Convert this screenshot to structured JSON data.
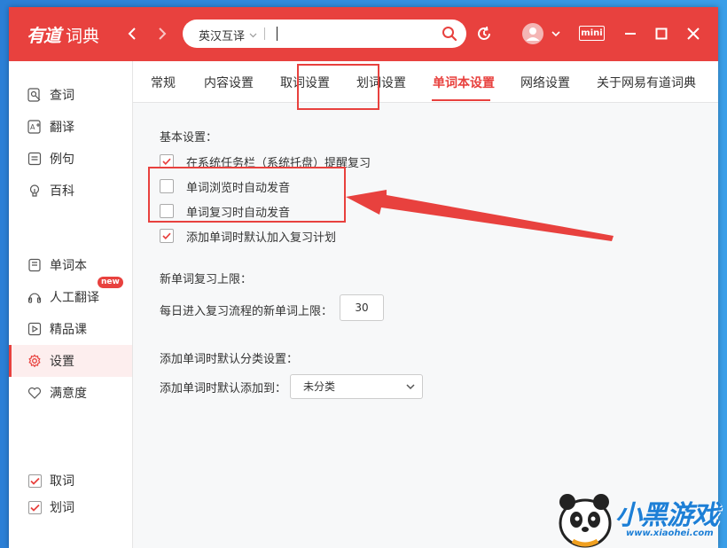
{
  "app": {
    "logo_mark": "有道",
    "logo_text": "词典"
  },
  "search": {
    "language": "英汉互译",
    "value": "",
    "placeholder": ""
  },
  "titlebar": {
    "mini_label": "mini"
  },
  "sidebar": {
    "items": [
      {
        "label": "查词",
        "icon": "search-doc-icon"
      },
      {
        "label": "翻译",
        "icon": "translate-icon"
      },
      {
        "label": "例句",
        "icon": "example-icon"
      },
      {
        "label": "百科",
        "icon": "bulb-icon"
      },
      {
        "label": "单词本",
        "icon": "wordbook-icon"
      },
      {
        "label": "人工翻译",
        "icon": "human-translate-icon",
        "badge": "new"
      },
      {
        "label": "精品课",
        "icon": "course-icon"
      },
      {
        "label": "设置",
        "icon": "gear-icon",
        "active": true
      },
      {
        "label": "满意度",
        "icon": "heart-icon"
      }
    ],
    "checks": [
      {
        "label": "取词",
        "checked": true
      },
      {
        "label": "划词",
        "checked": true
      }
    ]
  },
  "tabs": [
    {
      "label": "常规"
    },
    {
      "label": "内容设置"
    },
    {
      "label": "取词设置"
    },
    {
      "label": "划词设置"
    },
    {
      "label": "单词本设置",
      "active": true
    },
    {
      "label": "网络设置"
    },
    {
      "label": "关于网易有道词典"
    }
  ],
  "content": {
    "basic_title": "基本设置：",
    "options": [
      {
        "label": "在系统任务栏（系统托盘）提醒复习",
        "checked": true
      },
      {
        "label": "单词浏览时自动发音",
        "checked": false
      },
      {
        "label": "单词复习时自动发音",
        "checked": false
      },
      {
        "label": "添加单词时默认加入复习计划",
        "checked": true
      }
    ],
    "limit_title": "新单词复习上限：",
    "limit_label": "每日进入复习流程的新单词上限：",
    "limit_value": "30",
    "category_title": "添加单词时默认分类设置：",
    "category_label": "添加单词时默认添加到：",
    "category_value": "未分类"
  },
  "colors": {
    "brand": "#e8413e",
    "watermark": "#1d7fd6"
  },
  "watermark": {
    "text": "小黑游戏",
    "url": "www.xiaohei.com"
  }
}
